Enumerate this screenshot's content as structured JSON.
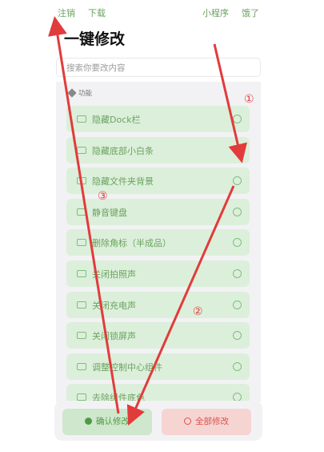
{
  "nav": {
    "logout": "注销",
    "download": "下载",
    "mini_program": "小程序",
    "lazy": "饿了"
  },
  "title": "一键修改",
  "search": {
    "placeholder": "搜索你要改内容"
  },
  "section": {
    "label": "功能"
  },
  "items": [
    {
      "label": "隐藏Dock栏",
      "checked": false
    },
    {
      "label": "隐藏底部小白条",
      "checked": true
    },
    {
      "label": "隐藏文件夹背景",
      "checked": false
    },
    {
      "label": "静音键盘",
      "checked": false
    },
    {
      "label": "删除角标（半成品）",
      "checked": false
    },
    {
      "label": "关闭拍照声",
      "checked": false
    },
    {
      "label": "关闭充电声",
      "checked": false
    },
    {
      "label": "关闭锁屏声",
      "checked": false
    },
    {
      "label": "调整控制中心组件",
      "checked": false
    },
    {
      "label": "去除组件底色",
      "checked": false
    }
  ],
  "buttons": {
    "confirm": "确认修改",
    "all": "全部修改"
  },
  "annotations": {
    "one": "①",
    "two": "②",
    "three": "③"
  },
  "colors": {
    "accent": "#6aa35e",
    "arrow": "#e23b3b",
    "danger": "#d9534f"
  }
}
